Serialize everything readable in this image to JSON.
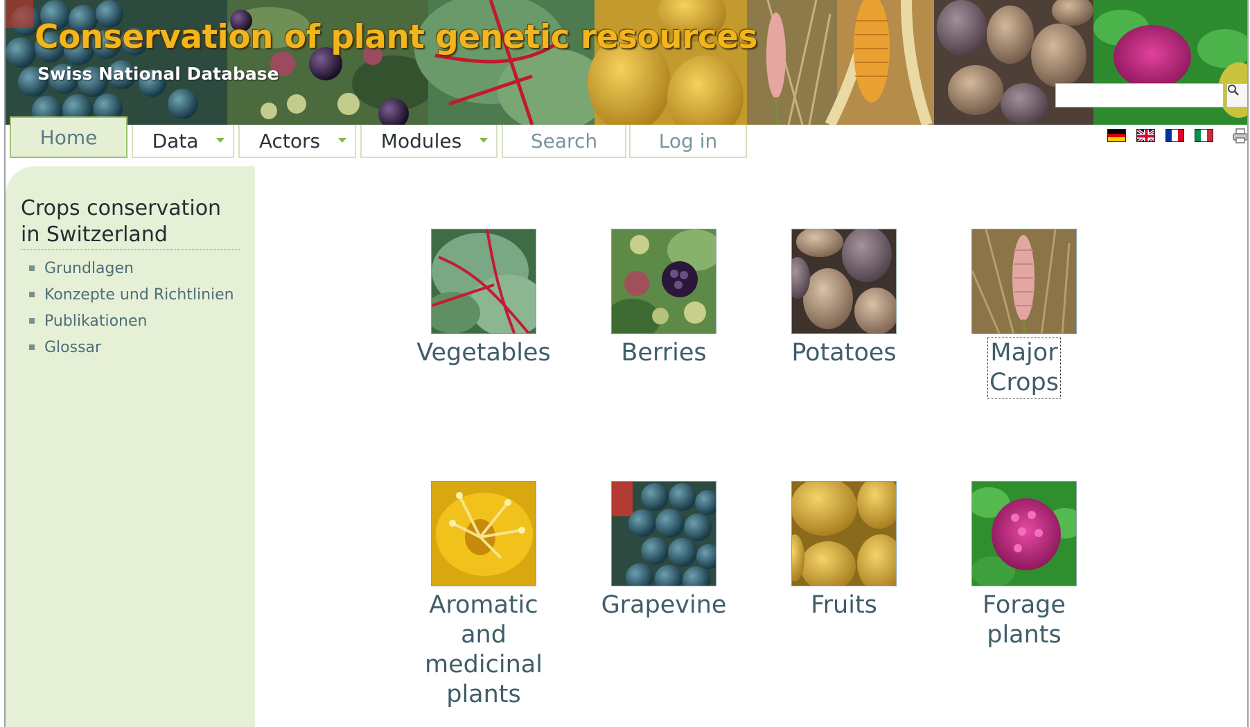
{
  "header": {
    "title": "Conservation of plant genetic resources",
    "subtitle": "Swiss National Database",
    "search_placeholder": ""
  },
  "nav": {
    "tabs": [
      {
        "label": "Home",
        "active": true,
        "has_menu": false
      },
      {
        "label": "Data",
        "active": false,
        "has_menu": true
      },
      {
        "label": "Actors",
        "active": false,
        "has_menu": true
      },
      {
        "label": "Modules",
        "active": false,
        "has_menu": true
      },
      {
        "label": "Search",
        "active": false,
        "has_menu": false
      },
      {
        "label": "Log in",
        "active": false,
        "has_menu": false
      }
    ],
    "languages": [
      "de-flag-icon",
      "uk-flag-icon",
      "fr-flag-icon",
      "it-flag-icon"
    ],
    "print_icon": "printer-icon"
  },
  "sidebar": {
    "title": "Crops conservation in Switzerland",
    "links": [
      "Grundlagen",
      "Konzepte und Richtlinien",
      "Publikationen",
      "Glossar"
    ]
  },
  "crops": [
    {
      "label": "Vegetables",
      "icon": "chard-leaf-image"
    },
    {
      "label": "Berries",
      "icon": "blackberry-image"
    },
    {
      "label": "Potatoes",
      "icon": "potatoes-image"
    },
    {
      "label": "Major Crops",
      "icon": "grain-ear-image"
    },
    {
      "label": "Aromatic and medicinal plants",
      "icon": "yellow-flower-image"
    },
    {
      "label": "Grapevine",
      "icon": "grapes-image"
    },
    {
      "label": "Fruits",
      "icon": "pears-image"
    },
    {
      "label": "Forage plants",
      "icon": "clover-image"
    }
  ],
  "colors": {
    "title": "#f2b51c",
    "sidebar_bg": "#e6f0d6",
    "nav_border": "#d4e2bd",
    "home_tab_border": "#9cc36b",
    "link_text": "#3f5e69"
  }
}
